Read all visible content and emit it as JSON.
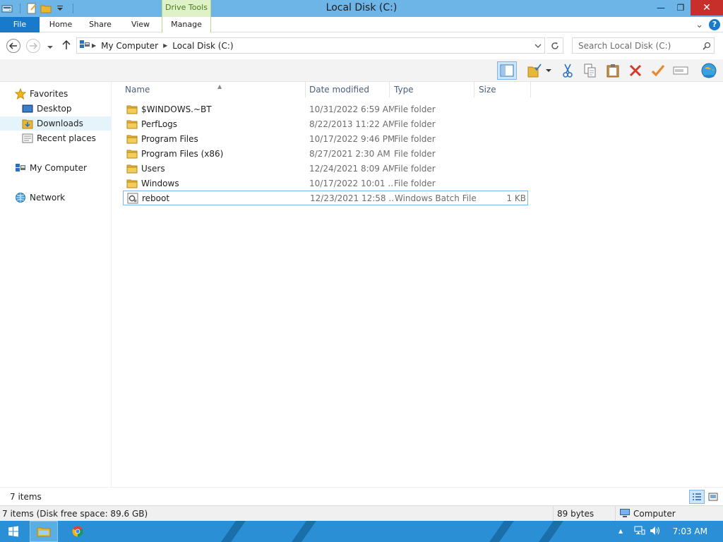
{
  "window": {
    "title": "Local Disk (C:)",
    "contextual_tab": "Drive Tools",
    "minimize_glyph": "—",
    "maximize_glyph": "❐",
    "close_glyph": "✕"
  },
  "ribbon": {
    "tabs": [
      "File",
      "Home",
      "Share",
      "View",
      "Manage"
    ],
    "expand_glyph": "⌄",
    "help_glyph": "?"
  },
  "address": {
    "crumbs": [
      "My Computer",
      "Local Disk (C:)"
    ],
    "search_placeholder": "Search Local Disk (C:)"
  },
  "navigation": {
    "favorites_label": "Favorites",
    "favorites": [
      "Desktop",
      "Downloads",
      "Recent places"
    ],
    "selected": "Downloads",
    "computer_label": "My Computer",
    "network_label": "Network"
  },
  "columns": {
    "name": "Name",
    "date": "Date modified",
    "type": "Type",
    "size": "Size"
  },
  "files": [
    {
      "name": "$WINDOWS.~BT",
      "date": "10/31/2022 6:59 AM",
      "type": "File folder",
      "size": "",
      "icon": "folder-icon"
    },
    {
      "name": "PerfLogs",
      "date": "8/22/2013 11:22 AM",
      "type": "File folder",
      "size": "",
      "icon": "folder-icon"
    },
    {
      "name": "Program Files",
      "date": "10/17/2022 9:46 PM",
      "type": "File folder",
      "size": "",
      "icon": "folder-icon"
    },
    {
      "name": "Program Files (x86)",
      "date": "8/27/2021 2:30 AM",
      "type": "File folder",
      "size": "",
      "icon": "folder-icon"
    },
    {
      "name": "Users",
      "date": "12/24/2021 8:09 AM",
      "type": "File folder",
      "size": "",
      "icon": "folder-icon"
    },
    {
      "name": "Windows",
      "date": "10/17/2022 10:01 ...",
      "type": "File folder",
      "size": "",
      "icon": "folder-icon"
    },
    {
      "name": "reboot",
      "date": "12/23/2021 12:58 ...",
      "type": "Windows Batch File",
      "size": "1 KB",
      "icon": "batch-file-icon"
    }
  ],
  "selected_file": "reboot",
  "items_count": "7 items",
  "status": {
    "left": "7 items (Disk free space: 89.6 GB)",
    "size": "89 bytes",
    "location": "Computer"
  },
  "taskbar": {
    "clock": "7:03 AM",
    "tray_up_glyph": "▲"
  },
  "colors": {
    "titlebar": "#6cb5e6",
    "file_tab": "#1979ca",
    "taskbar": "#2a8fd4",
    "selection_border": "#7eb4ea",
    "folder": "#e8b737"
  }
}
